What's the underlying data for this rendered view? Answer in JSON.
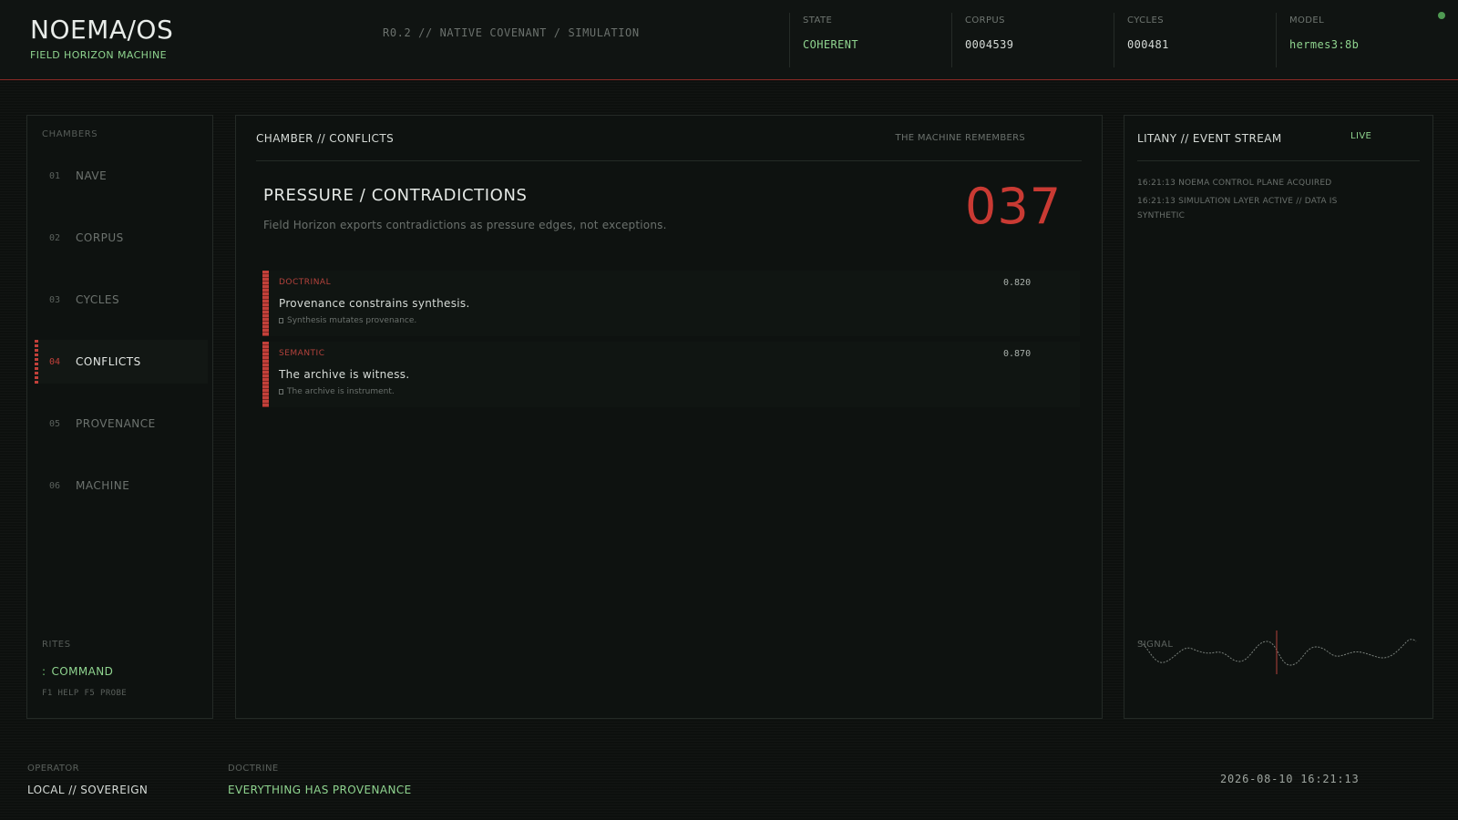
{
  "header": {
    "title": "NOEMA/OS",
    "subtitle": "FIELD HORIZON MACHINE",
    "release": "R0.2 // NATIVE COVENANT  /  SIMULATION",
    "stats": [
      {
        "label": "STATE",
        "value": "COHERENT"
      },
      {
        "label": "CORPUS",
        "value": "0004539"
      },
      {
        "label": "CYCLES",
        "value": "000481"
      },
      {
        "label": "MODEL",
        "value": "hermes3:8b"
      }
    ]
  },
  "sidebar": {
    "section_label": "CHAMBERS",
    "items": [
      {
        "num": "01",
        "label": "NAVE"
      },
      {
        "num": "02",
        "label": "CORPUS"
      },
      {
        "num": "03",
        "label": "CYCLES"
      },
      {
        "num": "04",
        "label": "CONFLICTS"
      },
      {
        "num": "05",
        "label": "PROVENANCE"
      },
      {
        "num": "06",
        "label": "MACHINE"
      }
    ],
    "rites_label": "RITES",
    "command_prompt": ":",
    "command_label": "COMMAND",
    "hint": "F1 HELP  F5 PROBE"
  },
  "main": {
    "chamber_title": "CHAMBER // CONFLICTS",
    "tagline": "THE MACHINE REMEMBERS",
    "section_title": "PRESSURE / CONTRADICTIONS",
    "section_desc": "Field Horizon exports contradictions as pressure edges, not exceptions.",
    "count": "037",
    "conflicts": [
      {
        "category": "DOCTRINAL",
        "score": "0.820",
        "statement": "Provenance constrains synthesis.",
        "counter": "Synthesis mutates provenance."
      },
      {
        "category": "SEMANTIC",
        "score": "0.870",
        "statement": "The archive is witness.",
        "counter": "The archive is instrument."
      }
    ]
  },
  "stream": {
    "title": "LITANY // EVENT STREAM",
    "live": "LIVE",
    "events": [
      "16:21:13  NOEMA CONTROL PLANE ACQUIRED",
      "16:21:13  SIMULATION LAYER ACTIVE // DATA IS SYNTHETIC"
    ],
    "signal_label": "SIGNAL"
  },
  "footer": {
    "operator_label": "OPERATOR",
    "operator_value": "LOCAL // SOVEREIGN",
    "doctrine_label": "DOCTRINE",
    "doctrine_value": "EVERYTHING HAS PROVENANCE",
    "clock": "2026-08-10  16:21:13"
  },
  "colors": {
    "accent_red": "#c93a33",
    "accent_green": "#8fd48f",
    "background": "#0d100e"
  },
  "active_chamber": "CONFLICTS"
}
